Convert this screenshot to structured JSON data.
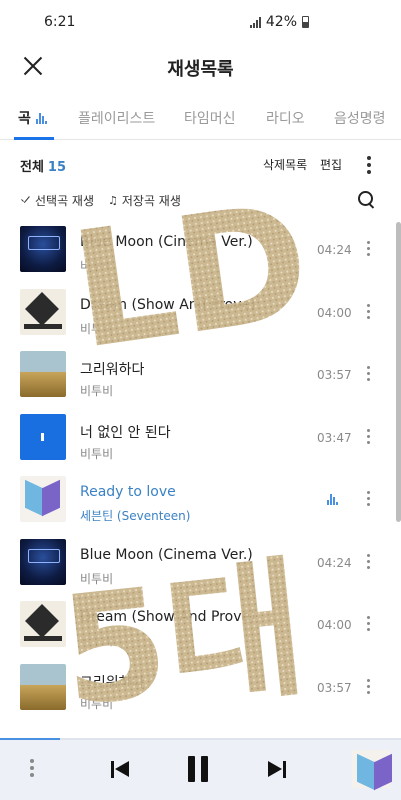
{
  "status_bar": {
    "time": "6:21",
    "battery": "42%"
  },
  "header": {
    "title": "재생목록"
  },
  "tabs": [
    {
      "label": "곡",
      "active": true
    },
    {
      "label": "플레이리스트",
      "active": false
    },
    {
      "label": "타임머신",
      "active": false
    },
    {
      "label": "라디오",
      "active": false
    },
    {
      "label": "음성명령",
      "active": false
    }
  ],
  "toolbar": {
    "total_label": "전체",
    "total_count": "15",
    "delete_list_label": "삭제목록",
    "edit_label": "편집"
  },
  "actions": {
    "select_play_label": "선택곡 재생",
    "saved_play_label": "저장곡 재생"
  },
  "songs": [
    {
      "title": "Blue Moon (Cinema Ver.)",
      "artist": "비투비",
      "duration": "04:24",
      "art": "bluemoon"
    },
    {
      "title": "Dream (Show And Prove)",
      "artist": "비투비",
      "duration": "04:00",
      "art": "frame"
    },
    {
      "title": "그리워하다",
      "artist": "비투비",
      "duration": "03:57",
      "art": "field"
    },
    {
      "title": "너 없인 안 된다",
      "artist": "비투비",
      "duration": "03:47",
      "art": "blue"
    },
    {
      "title": "Ready to love",
      "artist": "세븐틴 (Seventeen)",
      "duration": "",
      "art": "pastel",
      "playing": true
    },
    {
      "title": "Blue Moon (Cinema Ver.)",
      "artist": "비투비",
      "duration": "04:24",
      "art": "bluemoon"
    },
    {
      "title": "Dream (Show And Prove)",
      "artist": "비투비",
      "duration": "04:00",
      "art": "frame"
    },
    {
      "title": "그리워하다",
      "artist": "비투비",
      "duration": "03:57",
      "art": "field"
    }
  ],
  "player": {
    "progress": 0.15
  },
  "overlay": {
    "top_text": "LD",
    "bottom_text": "5대",
    "color": "#c9b48a"
  },
  "colors": {
    "accent": "#3b82c4",
    "player_bg": "#eef0f8"
  }
}
